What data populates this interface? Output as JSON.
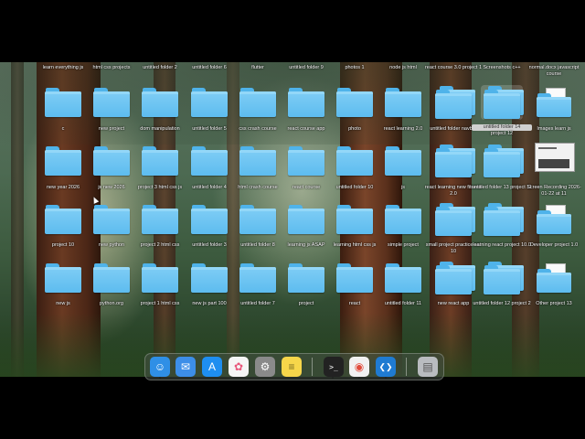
{
  "top_row_labels": [
    {
      "id": "learn-everything-js",
      "text": "learn everything js"
    },
    {
      "id": "html-css-projects",
      "text": "html css projects"
    },
    {
      "id": "untitled-folder-2",
      "text": "untitled folder 2"
    },
    {
      "id": "untitled-folder-6",
      "text": "untitled folder 6"
    },
    {
      "id": "flutter",
      "text": "flutter"
    },
    {
      "id": "untitled-folder-9",
      "text": "untitled folder 9"
    },
    {
      "id": "photos-1",
      "text": "photos 1"
    },
    {
      "id": "node-js-html",
      "text": "node js html"
    },
    {
      "id": "react-course-3-0-project-1",
      "text": "react course 3.0 project 1"
    },
    {
      "id": "screenshots-cpp",
      "text": "Screenshots c++"
    },
    {
      "id": "normal-docx",
      "text": "normal.docx javascript course"
    }
  ],
  "row1": [
    {
      "label": "c"
    },
    {
      "label": "new project"
    },
    {
      "label": "dom manipulation"
    },
    {
      "label": "untitled folder 5"
    },
    {
      "label": "css crash course"
    },
    {
      "label": "react course app"
    },
    {
      "label": "photo"
    },
    {
      "label": "react learning 2.0"
    },
    {
      "label": "untitled folder navbar"
    },
    {
      "label": "untitled folder 14",
      "sub": "project 12"
    },
    {
      "label": "Images learn js"
    }
  ],
  "row2": [
    {
      "label": "new year 2026"
    },
    {
      "label": "js new 2026"
    },
    {
      "label": "project 3 html css js"
    },
    {
      "label": "untitled folder 4"
    },
    {
      "label": "html crash course"
    },
    {
      "label": "react course"
    },
    {
      "label": "untitled folder 10"
    },
    {
      "label": "js"
    },
    {
      "label": "react learning new fitness 2.0"
    },
    {
      "label": "untitled folder 13 project 11"
    },
    {
      "label": "Screen Recording 2026-01-22 at 11"
    }
  ],
  "row3": [
    {
      "label": "project 10"
    },
    {
      "label": "new python"
    },
    {
      "label": "project 2 html css"
    },
    {
      "label": "untitled folder 3"
    },
    {
      "label": "untitled folder 8"
    },
    {
      "label": "learning js ASAP"
    },
    {
      "label": "learning html css js"
    },
    {
      "label": "simple project"
    },
    {
      "label": "small project practice set 10"
    },
    {
      "label": "learning react project 10.0"
    },
    {
      "label": "Developer project 1.0"
    }
  ],
  "row4": [
    {
      "label": "new js"
    },
    {
      "label": "python.org"
    },
    {
      "label": "project 1 html css"
    },
    {
      "label": "new js part 100"
    },
    {
      "label": "untitled folder 7"
    },
    {
      "label": "project"
    },
    {
      "label": "react"
    },
    {
      "label": "untitled folder 11"
    },
    {
      "label": "new react app"
    },
    {
      "label": "untitled folder 12 project 2"
    },
    {
      "label": "Other project 13"
    }
  ],
  "dock": [
    {
      "name": "finder-icon",
      "color": "#2f8fe6"
    },
    {
      "name": "mail-icon",
      "color": "#3d8ee8"
    },
    {
      "name": "app-store-icon",
      "color": "#1e8ef0"
    },
    {
      "name": "photos-icon",
      "color": "#f5f5f5"
    },
    {
      "name": "system-settings-icon",
      "color": "#8a8a8a"
    },
    {
      "name": "notes-icon",
      "color": "#f7d64a"
    },
    {
      "name": "terminal-icon",
      "color": "#222222"
    },
    {
      "name": "chrome-icon",
      "color": "#f1f1f1"
    },
    {
      "name": "vscode-icon",
      "color": "#1f7bd2"
    },
    {
      "name": "trash-icon",
      "color": "#b9bcc0"
    }
  ]
}
